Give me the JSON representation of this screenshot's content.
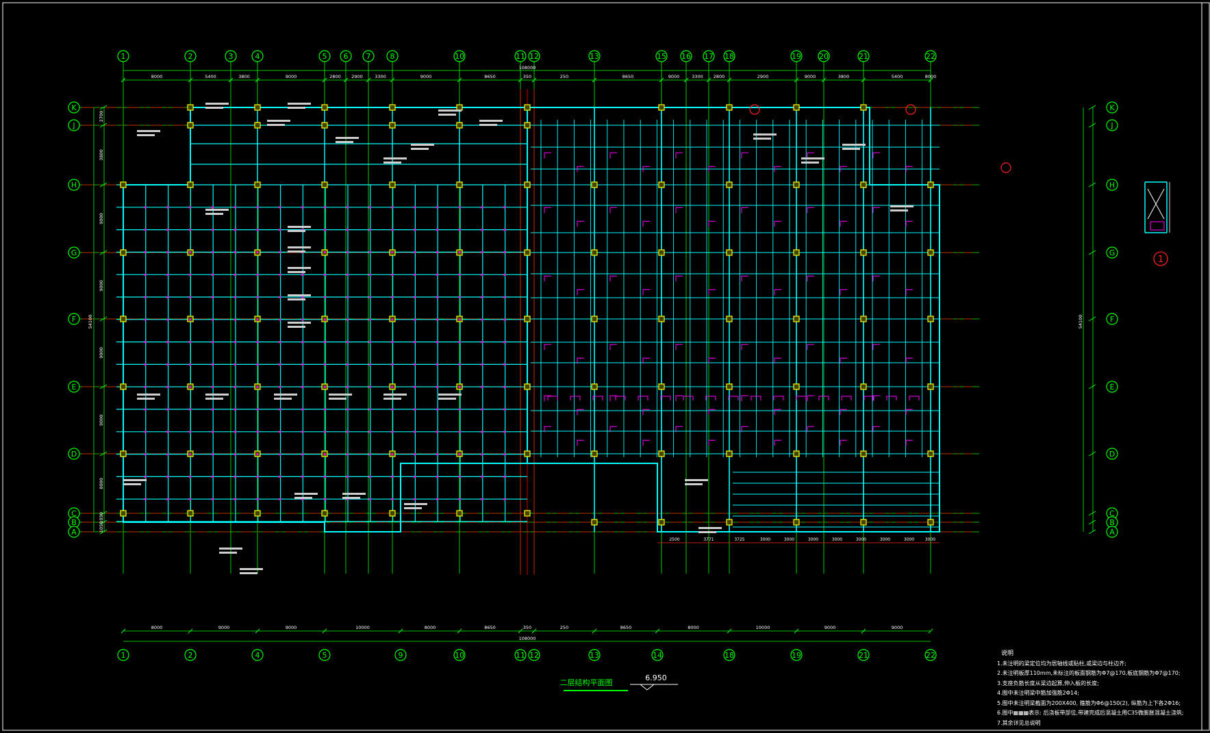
{
  "drawing": {
    "title": "二层结构平面图",
    "elevation": "6.950",
    "detail_marker": "1"
  },
  "grid": {
    "columns": [
      "1",
      "2",
      "3",
      "4",
      "5",
      "6",
      "7",
      "8",
      "10",
      "11",
      "12",
      "13",
      "15",
      "16",
      "17",
      "18",
      "19",
      "20",
      "21",
      "22"
    ],
    "columns_bottom": [
      "1",
      "2",
      "4",
      "5",
      "9",
      "10",
      "11",
      "12",
      "13",
      "14",
      "18",
      "19",
      "21",
      "22"
    ],
    "rows": [
      "K",
      "J",
      "H",
      "G",
      "F",
      "E",
      "D",
      "C",
      "B",
      "A"
    ]
  },
  "dimensions": {
    "top": [
      "8000",
      "5400",
      "3800",
      "9000",
      "2800",
      "2900",
      "3300",
      "9000",
      "8650",
      "350",
      "250",
      "8650",
      "9000",
      "3300",
      "2800",
      "2900",
      "9000",
      "3800",
      "5400",
      "8000"
    ],
    "top_total": "108000",
    "bottom": [
      "8000",
      "9000",
      "9000",
      "10000",
      "8000",
      "8650",
      "350",
      "250",
      "8650",
      "8000",
      "10000",
      "9000",
      "9000",
      "8000"
    ],
    "bottom_total": "108000",
    "side_total": "54100",
    "left_rows": [
      "2700",
      "3800",
      "9000",
      "9000",
      "9000",
      "9000",
      "8000",
      "1050",
      "1050"
    ],
    "right_small": [
      "2500",
      "3771",
      "3725",
      "3000",
      "3000",
      "3000",
      "3000",
      "3000",
      "3000",
      "3000",
      "3000",
      "1200"
    ]
  },
  "notes": {
    "heading": "说明",
    "lines": [
      "1.未注明的梁定位均为居轴线或贴柱,或梁边与柱边齐;",
      "2.未注明板厚110mm,未标注的板面钢筋为Φ7@170,板底钢筋为Φ7@170;",
      "3.支座负筋长度从梁边起算,伸入板的长度;",
      "4.图中未注明梁中筋加强筋2Φ14;",
      "5.图中未注明梁截面为200X400, 箍筋为Φ6@150(2), 纵筋为上下各2Φ16;",
      "6.图中▦▦▦表示: 后浇板带部位,带建完成后混凝土用C35微膨胀混凝土浇筑;",
      "7.其余详见总说明"
    ]
  },
  "colors": {
    "background": "#000000",
    "grid_axis": "#00ff00",
    "beam": "#00ffff",
    "centerline": "#ff0000",
    "rebar": "#ff00ff",
    "column": "#ffff00",
    "text": "#ffffff"
  }
}
